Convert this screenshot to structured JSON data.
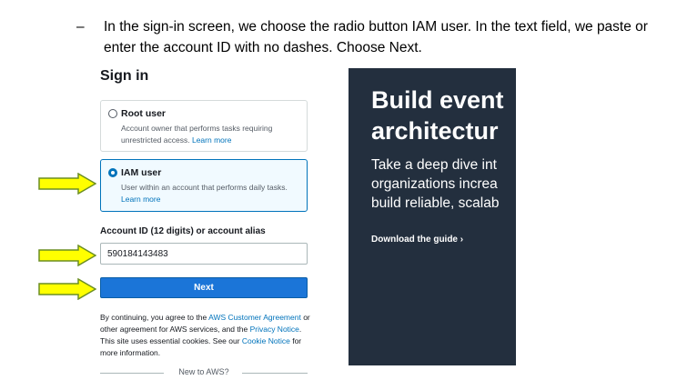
{
  "instruction": {
    "dash": "–",
    "text": "In the sign-in screen, we choose the radio button IAM user. In the text field, we paste or enter the account ID with no dashes. Choose Next."
  },
  "signin": {
    "title": "Sign in",
    "options": [
      {
        "title": "Root user",
        "description": "Account owner that performs tasks requiring unrestricted access.",
        "link": "Learn more",
        "selected": false
      },
      {
        "title": "IAM user",
        "description": "User within an account that performs daily tasks.",
        "link": "Learn more",
        "selected": true
      }
    ],
    "account_label": "Account ID (12 digits) or account alias",
    "account_value": "590184143483",
    "next_label": "Next",
    "legal": {
      "t1": "By continuing, you agree to the ",
      "l1": "AWS Customer Agreement",
      "t2": " or other agreement for AWS services, and the ",
      "l2": "Privacy Notice",
      "t3": ". This site uses essential cookies. See our ",
      "l3": "Cookie Notice",
      "t4": " for more information."
    },
    "new_to_aws": "New to AWS?"
  },
  "ad": {
    "headline_line1": "Build event",
    "headline_line2": "architectur",
    "sub_line1": "Take a deep dive int",
    "sub_line2": "organizations increa",
    "sub_line3": "build reliable, scalab",
    "link": "Download the guide ›"
  },
  "colors": {
    "link_blue": "#0073bb",
    "button_blue": "#1b75d8",
    "arrow_fill": "#ffff00",
    "arrow_stroke": "#6b8e23",
    "ad_background": "#232f3e"
  },
  "icons": [
    "arrow-right-icon",
    "radio-icon"
  ]
}
